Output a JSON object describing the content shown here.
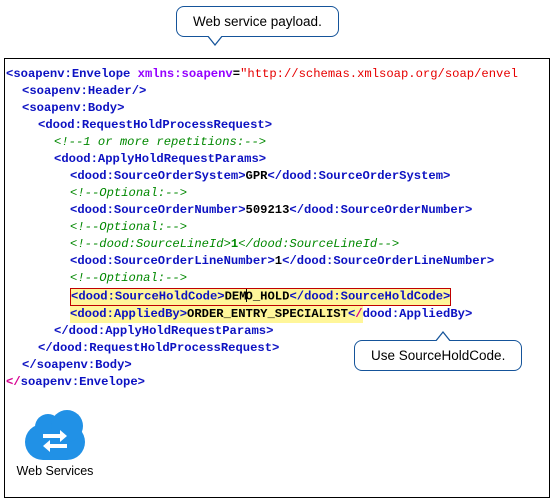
{
  "callouts": {
    "top": "Web service  payload.",
    "bottom": "Use SourceHoldCode."
  },
  "ws_label": "Web Services",
  "code": {
    "l01": {
      "open": "<soapenv:Envelope ",
      "attr": "xmlns:soapenv",
      "eq": "=",
      "val": "\"http://schemas.xmlsoap.org/soap/envel"
    },
    "l02": {
      "open": "<soapenv:Header/>"
    },
    "l03": {
      "open": "<soapenv:Body>"
    },
    "l04": {
      "open": "<dood:RequestHoldProcessRequest>"
    },
    "l05": {
      "comm": "<!--1 or more repetitions:-->"
    },
    "l06": {
      "open": "<dood:ApplyHoldRequestParams>"
    },
    "l07": {
      "open": "<dood:SourceOrderSystem>",
      "text": "GPR",
      "close": "</dood:SourceOrderSystem>"
    },
    "l08": {
      "comm": "<!--Optional:-->"
    },
    "l09": {
      "open": "<dood:SourceOrderNumber>",
      "text": "509213",
      "close": "</dood:SourceOrderNumber>"
    },
    "l10": {
      "comm": "<!--Optional:-->"
    },
    "l11": {
      "comm1": "<!--dood:SourceLineId>",
      "text": "1",
      "comm2": "</dood:SourceLineId-->"
    },
    "l12": {
      "open": "<dood:SourceOrderLineNumber>",
      "text": "1",
      "close": "</dood:SourceOrderLineNumber>"
    },
    "l13": {
      "comm": "<!--Optional:-->"
    },
    "l14": {
      "open": "<dood:SourceHoldCode>",
      "t1": "DEM",
      "t2": "O_HOLD",
      "close": "</dood:SourceHoldCode>"
    },
    "l15": {
      "open": "<dood:AppliedBy>",
      "text": "ORDER_ENTRY_SPECIALIST",
      "close_a": "<",
      "close_b": "/",
      "close_c": "dood:AppliedBy>"
    },
    "l16": {
      "close": "</dood:ApplyHoldRequestParams>"
    },
    "l17": {
      "close": "</dood:RequestHoldProcessRequest>"
    },
    "l18": {
      "close": "</soapenv:Body>"
    },
    "l19": {
      "close_plain": "soapenv:Envelope>"
    }
  }
}
